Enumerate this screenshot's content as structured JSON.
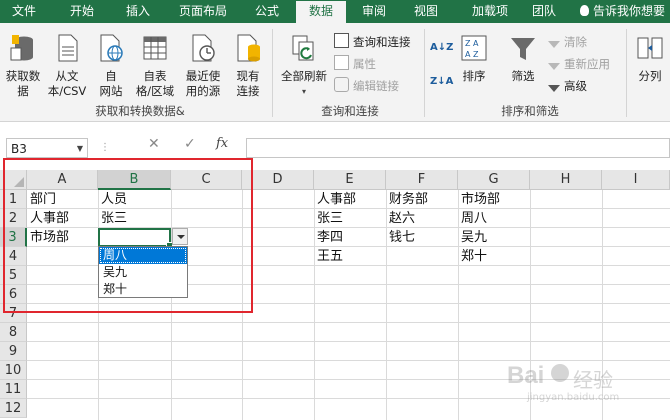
{
  "tabs": [
    "文件",
    "开始",
    "插入",
    "页面布局",
    "公式",
    "数据",
    "审阅",
    "视图",
    "加载项",
    "团队"
  ],
  "active_tab": "数据",
  "tell_me": "告诉我你想要",
  "ribbon": {
    "get_external_data": [
      "获取数",
      "据"
    ],
    "from_text_csv": [
      "从文",
      "本/CSV"
    ],
    "from_web": [
      "自",
      "网站"
    ],
    "from_table": [
      "自表",
      "格/区域"
    ],
    "recent_sources": [
      "最近使",
      "用的源"
    ],
    "existing_connections": [
      "现有",
      "连接"
    ],
    "group_get_transform": "获取和转换数据&",
    "refresh_all": [
      "全部刷新"
    ],
    "queries_connections": "查询和连接",
    "properties": "属性",
    "edit_links": "编辑链接",
    "group_queries": "查询和连接",
    "sort_az": "A↓Z",
    "sort_za": "Z↓A",
    "sort": "排序",
    "filter": "筛选",
    "clear": "清除",
    "reapply": "重新应用",
    "advanced": "高级",
    "group_sort_filter": "排序和筛选",
    "split": "分列"
  },
  "formula_bar": {
    "name_box": "B3",
    "cancel": "✕",
    "enter": "✓",
    "fx": "fx",
    "value": ""
  },
  "columns": [
    "A",
    "B",
    "C",
    "D",
    "E",
    "F",
    "G",
    "H",
    "I"
  ],
  "rows": [
    "1",
    "2",
    "3",
    "4",
    "5",
    "6",
    "7",
    "8",
    "9",
    "10",
    "11",
    "12"
  ],
  "cells": {
    "A1": "部门",
    "B1": "人员",
    "A2": "人事部",
    "B2": "张三",
    "A3": "市场部",
    "E1": "人事部",
    "F1": "财务部",
    "G1": "市场部",
    "E2": "张三",
    "F2": "赵六",
    "G2": "周八",
    "E3": "李四",
    "F3": "钱七",
    "G3": "吴九",
    "E4": "王五",
    "G4": "郑十"
  },
  "dropdown_options": [
    "周八",
    "吴九",
    "郑十"
  ],
  "dropdown_selected": "周八",
  "watermark": {
    "brand": "Bai",
    "suffix": "经验",
    "url": "jingyan.baidu.com"
  }
}
